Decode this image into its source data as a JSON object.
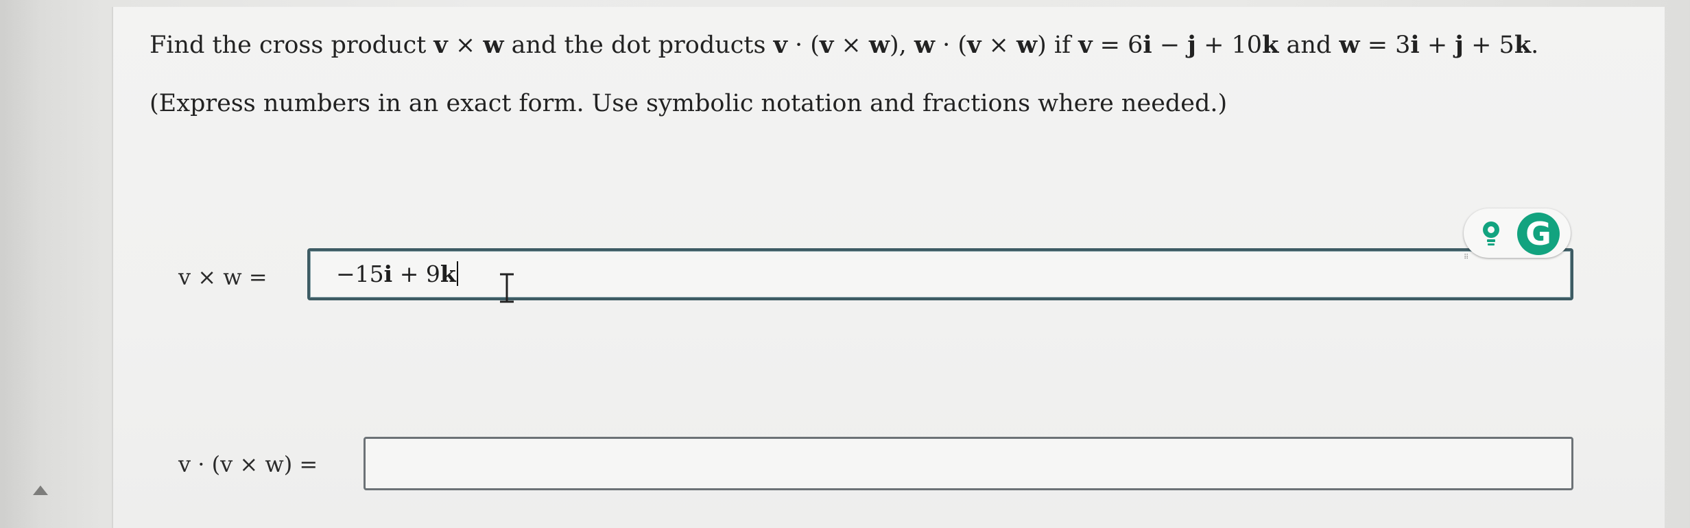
{
  "question": {
    "text_before_v": "Find the cross product ",
    "v": "v",
    "times1": " × ",
    "w": "w",
    "mid1": " and the dot products ",
    "v2": "v",
    "dot1": " · (",
    "v3": "v",
    "times2": " × ",
    "w2": "w",
    "sep": "), ",
    "w3": "w",
    "dot2": " · (",
    "v4": "v",
    "times3": " × ",
    "w4": "w",
    "if_part": ") if ",
    "v5": "v",
    "eq1": " = 6",
    "i1": "i",
    "minus": " − ",
    "j1": "j",
    "plus1": " + 10",
    "k1": "k",
    "and_part": " and ",
    "w5": "w",
    "eq2": " = 3",
    "i2": "i",
    "plus2": " + ",
    "j2": "j",
    "plus3": " + 5",
    "k2": "k",
    "end": "."
  },
  "note": "(Express numbers in an exact form. Use symbolic notation and fractions where needed.)",
  "answers": [
    {
      "label": "v × w =",
      "value_prefix": "−15",
      "value_i": "i",
      "value_mid": " + 9",
      "value_k": "k"
    },
    {
      "label": "v · (v × w) =",
      "value": ""
    }
  ],
  "grammarly": {
    "logo_letter": "G",
    "icons": [
      "lightbulb-icon",
      "grammarly-logo-icon"
    ],
    "accent": "#12a37f"
  },
  "colors": {
    "active_border": "#3d5b63",
    "inactive_border": "#6c7276",
    "panel_bg": "#f3f3f2"
  }
}
